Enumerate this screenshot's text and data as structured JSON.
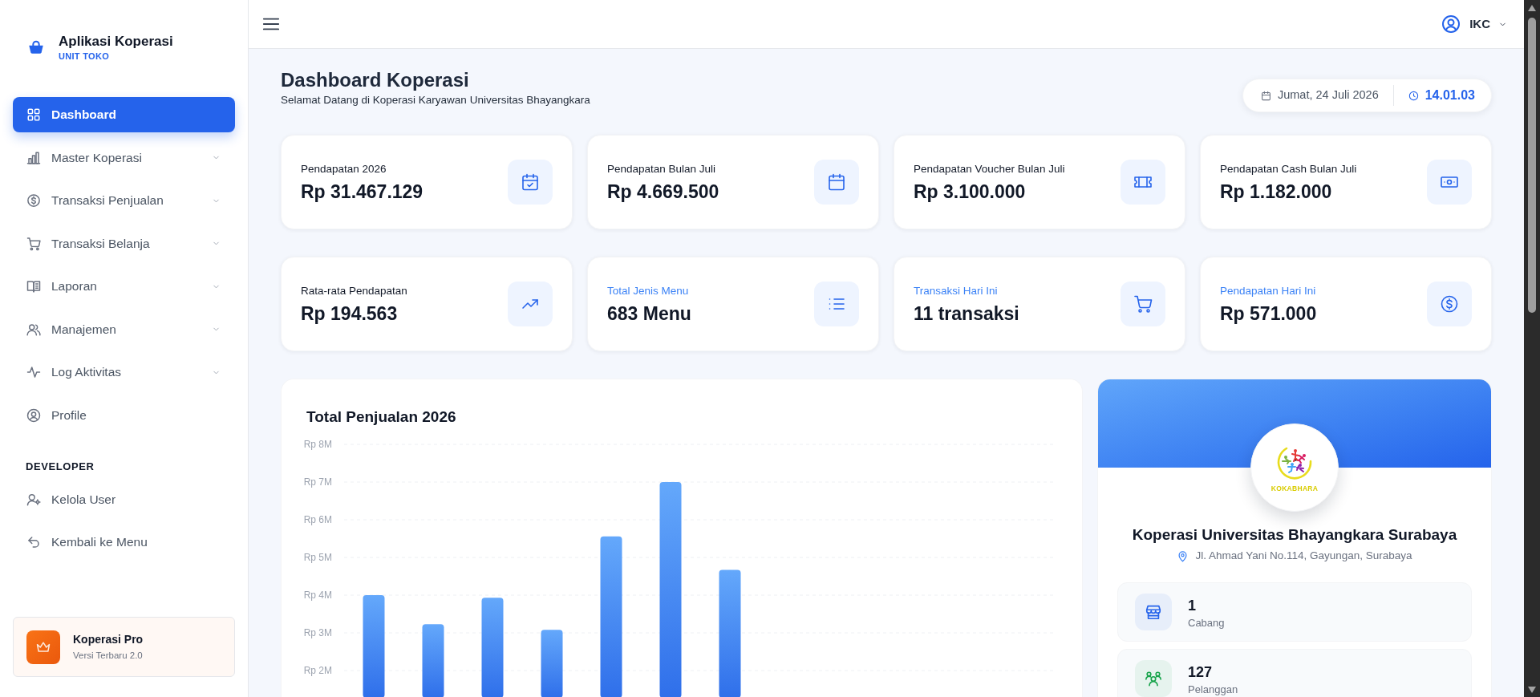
{
  "sidebar": {
    "brand": {
      "title": "Aplikasi Koperasi",
      "subtitle": "UNIT TOKO"
    },
    "menu": [
      {
        "label": "Dashboard",
        "kind": "link",
        "selected": true
      },
      {
        "label": "Master Koperasi",
        "kind": "submenu",
        "selected": false
      },
      {
        "label": "Transaksi Penjualan",
        "kind": "submenu",
        "selected": false
      },
      {
        "label": "Transaksi Belanja",
        "kind": "submenu",
        "selected": false
      },
      {
        "label": "Laporan",
        "kind": "submenu",
        "selected": false
      },
      {
        "label": "Manajemen",
        "kind": "submenu",
        "selected": false
      },
      {
        "label": "Log Aktivitas",
        "kind": "submenu",
        "selected": false
      },
      {
        "label": "Profile",
        "kind": "link",
        "selected": false
      }
    ],
    "sections": [
      {
        "heading": "DEVELOPER",
        "items": [
          {
            "label": "Kelola User",
            "selected": false
          },
          {
            "label": "Kembali ke Menu",
            "selected": false
          }
        ]
      }
    ],
    "promo": {
      "title": "Koperasi Pro",
      "subtitle": "Versi Terbaru 2.0"
    }
  },
  "header": {
    "user": "IKC"
  },
  "page": {
    "title": "Dashboard Koperasi",
    "subtitle": "Selamat Datang di Koperasi Karyawan Universitas Bhayangkara",
    "date": "Jumat, 24 Juli 2026",
    "time": "14.01.03"
  },
  "stat_cards": [
    {
      "label": "Pendapatan 2026",
      "value": "Rp 31.467.129",
      "highlighted": false
    },
    {
      "label": "Pendapatan Bulan Juli",
      "value": "Rp 4.669.500",
      "highlighted": false
    },
    {
      "label": "Pendapatan Voucher Bulan Juli",
      "value": "Rp 3.100.000",
      "highlighted": false
    },
    {
      "label": "Pendapatan Cash Bulan Juli",
      "value": "Rp 1.182.000",
      "highlighted": false
    },
    {
      "label": "Rata-rata Pendapatan",
      "value": "Rp 194.563",
      "highlighted": false
    },
    {
      "label": "Total Jenis Menu",
      "value": "683 Menu",
      "highlighted": true
    },
    {
      "label": "Transaksi Hari Ini",
      "value": "11 transaksi",
      "highlighted": true
    },
    {
      "label": "Pendapatan Hari Ini",
      "value": "Rp 571.000",
      "highlighted": true
    }
  ],
  "sales_chart": {
    "title": "Total Penjualan 2026",
    "axis_labels": [
      "Rp 8M",
      "Rp 7M",
      "Rp 6M",
      "Rp 5M",
      "Rp 4M",
      "Rp 3M",
      "Rp 2M"
    ]
  },
  "profile": {
    "logo_text": "KOKABHARA",
    "name": "Koperasi Universitas Bhayangkara Surabaya",
    "address": "Jl. Ahmad Yani No.114, Gayungan, Surabaya",
    "stats": [
      {
        "value": "1",
        "label": "Cabang",
        "color": "#2563eb"
      },
      {
        "value": "127",
        "label": "Pelanggan",
        "color": "#16a34a"
      }
    ]
  }
}
